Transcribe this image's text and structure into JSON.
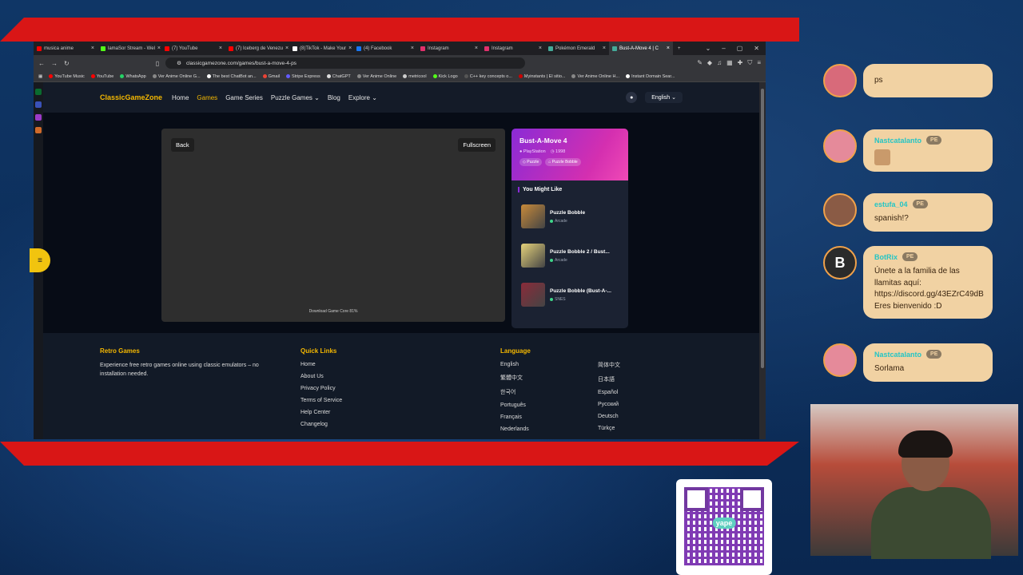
{
  "browser": {
    "tabs": [
      {
        "label": "musica anime",
        "color": "#ff0000"
      },
      {
        "label": "lamaSor Stream - Wel",
        "color": "#53fc18"
      },
      {
        "label": "(7) YouTube",
        "color": "#ff0000"
      },
      {
        "label": "(7) Iceberg de Venezu",
        "color": "#ff0000"
      },
      {
        "label": "(8)TikTok - Make Your",
        "color": "#ffffff"
      },
      {
        "label": "(4) Facebook",
        "color": "#1877f2"
      },
      {
        "label": "Instagram",
        "color": "#e1306c"
      },
      {
        "label": "Instagram",
        "color": "#e1306c"
      },
      {
        "label": "Pokémon Emerald",
        "color": "#4a9"
      },
      {
        "label": "Bust-A-Move 4 | C",
        "color": "#4a9",
        "active": true
      }
    ],
    "url": "classicgamezone.com/games/bust-a-move-4-ps",
    "bookmarks": [
      {
        "label": "YouTube Music",
        "color": "#ff0000"
      },
      {
        "label": "YouTube",
        "color": "#ff0000"
      },
      {
        "label": "WhatsApp",
        "color": "#25d366"
      },
      {
        "label": "Ver Anime Online G...",
        "color": "#888"
      },
      {
        "label": "The best ChatBot an...",
        "color": "#fff"
      },
      {
        "label": "Gmail",
        "color": "#ea4335"
      },
      {
        "label": "Stripe Express",
        "color": "#635bff"
      },
      {
        "label": "ChatGPT",
        "color": "#ddd"
      },
      {
        "label": "Ver Anime Online",
        "color": "#888"
      },
      {
        "label": "metricool",
        "color": "#ccc"
      },
      {
        "label": "Kick Logo",
        "color": "#53fc18"
      },
      {
        "label": "C++ key concepts o...",
        "color": "#555"
      },
      {
        "label": "Myinstants | El sitio...",
        "color": "#c00"
      },
      {
        "label": "Ver Anime Online H...",
        "color": "#888"
      },
      {
        "label": "Instant Domain Sear...",
        "color": "#fff"
      }
    ]
  },
  "site": {
    "logo": "ClassicGameZone",
    "nav": [
      "Home",
      "Games",
      "Game Series",
      "Puzzle Games",
      "Blog",
      "Explore"
    ],
    "language": "English",
    "player": {
      "back": "Back",
      "fullscreen": "Fullscreen",
      "progress": "Download Game Core 81%"
    },
    "game": {
      "title": "Bust-A-Move 4",
      "platform": "PlayStation",
      "year": "1998",
      "tags": [
        "Puzzle",
        "Puzzle Bobble"
      ]
    },
    "you_might_like": "You Might Like",
    "recommendations": [
      {
        "title": "Puzzle Bobble",
        "category": "Arcade",
        "color": "#c88a3a"
      },
      {
        "title": "Puzzle Bobble 2 / Bust...",
        "category": "Arcade",
        "color": "#e5d27a"
      },
      {
        "title": "Puzzle Bobble (Bust-A-...",
        "category": "SNES",
        "color": "#8a2b3a"
      }
    ],
    "footer": {
      "retro_heading": "Retro Games",
      "retro_desc": "Experience free retro games online using classic emulators – no installation needed.",
      "quick_heading": "Quick Links",
      "quick_links": [
        "Home",
        "About Us",
        "Privacy Policy",
        "Terms of Service",
        "Help Center",
        "Changelog"
      ],
      "lang_heading": "Language",
      "languages_left": [
        "English",
        "繁體中文",
        "한국어",
        "Português",
        "Français",
        "Nederlands"
      ],
      "languages_right": [
        "简体中文",
        "日本語",
        "Español",
        "Русский",
        "Deutsch",
        "Türkçe"
      ]
    }
  },
  "chat": [
    {
      "name": "",
      "badge": "",
      "text": "ps"
    },
    {
      "name": "Nastcatalanto",
      "badge": "PE",
      "text": ""
    },
    {
      "name": "estufa_04",
      "badge": "PE",
      "text": "spanish!?"
    },
    {
      "name": "BotRix",
      "badge": "PE",
      "text": "Únete a la familia de las llamitas aquí: https://discord.gg/43EZrC49dB Eres bienvenido :D"
    },
    {
      "name": "Nastcatalanto",
      "badge": "PE",
      "text": "Sorlama"
    }
  ],
  "qr": {
    "label": "yape"
  }
}
